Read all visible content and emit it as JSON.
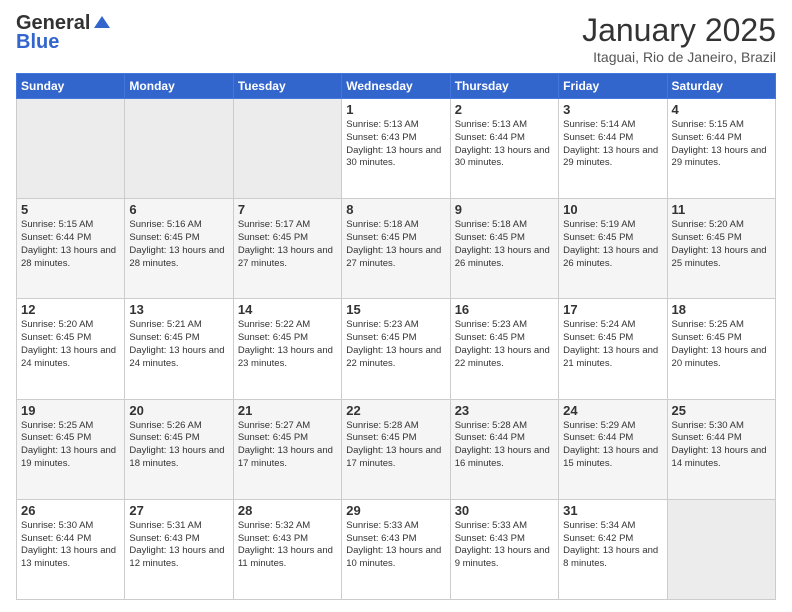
{
  "header": {
    "logo_general": "General",
    "logo_blue": "Blue",
    "month": "January 2025",
    "location": "Itaguai, Rio de Janeiro, Brazil"
  },
  "days_of_week": [
    "Sunday",
    "Monday",
    "Tuesday",
    "Wednesday",
    "Thursday",
    "Friday",
    "Saturday"
  ],
  "weeks": [
    [
      {
        "day": "",
        "info": ""
      },
      {
        "day": "",
        "info": ""
      },
      {
        "day": "",
        "info": ""
      },
      {
        "day": "1",
        "info": "Sunrise: 5:13 AM\nSunset: 6:43 PM\nDaylight: 13 hours and 30 minutes."
      },
      {
        "day": "2",
        "info": "Sunrise: 5:13 AM\nSunset: 6:44 PM\nDaylight: 13 hours and 30 minutes."
      },
      {
        "day": "3",
        "info": "Sunrise: 5:14 AM\nSunset: 6:44 PM\nDaylight: 13 hours and 29 minutes."
      },
      {
        "day": "4",
        "info": "Sunrise: 5:15 AM\nSunset: 6:44 PM\nDaylight: 13 hours and 29 minutes."
      }
    ],
    [
      {
        "day": "5",
        "info": "Sunrise: 5:15 AM\nSunset: 6:44 PM\nDaylight: 13 hours and 28 minutes."
      },
      {
        "day": "6",
        "info": "Sunrise: 5:16 AM\nSunset: 6:45 PM\nDaylight: 13 hours and 28 minutes."
      },
      {
        "day": "7",
        "info": "Sunrise: 5:17 AM\nSunset: 6:45 PM\nDaylight: 13 hours and 27 minutes."
      },
      {
        "day": "8",
        "info": "Sunrise: 5:18 AM\nSunset: 6:45 PM\nDaylight: 13 hours and 27 minutes."
      },
      {
        "day": "9",
        "info": "Sunrise: 5:18 AM\nSunset: 6:45 PM\nDaylight: 13 hours and 26 minutes."
      },
      {
        "day": "10",
        "info": "Sunrise: 5:19 AM\nSunset: 6:45 PM\nDaylight: 13 hours and 26 minutes."
      },
      {
        "day": "11",
        "info": "Sunrise: 5:20 AM\nSunset: 6:45 PM\nDaylight: 13 hours and 25 minutes."
      }
    ],
    [
      {
        "day": "12",
        "info": "Sunrise: 5:20 AM\nSunset: 6:45 PM\nDaylight: 13 hours and 24 minutes."
      },
      {
        "day": "13",
        "info": "Sunrise: 5:21 AM\nSunset: 6:45 PM\nDaylight: 13 hours and 24 minutes."
      },
      {
        "day": "14",
        "info": "Sunrise: 5:22 AM\nSunset: 6:45 PM\nDaylight: 13 hours and 23 minutes."
      },
      {
        "day": "15",
        "info": "Sunrise: 5:23 AM\nSunset: 6:45 PM\nDaylight: 13 hours and 22 minutes."
      },
      {
        "day": "16",
        "info": "Sunrise: 5:23 AM\nSunset: 6:45 PM\nDaylight: 13 hours and 22 minutes."
      },
      {
        "day": "17",
        "info": "Sunrise: 5:24 AM\nSunset: 6:45 PM\nDaylight: 13 hours and 21 minutes."
      },
      {
        "day": "18",
        "info": "Sunrise: 5:25 AM\nSunset: 6:45 PM\nDaylight: 13 hours and 20 minutes."
      }
    ],
    [
      {
        "day": "19",
        "info": "Sunrise: 5:25 AM\nSunset: 6:45 PM\nDaylight: 13 hours and 19 minutes."
      },
      {
        "day": "20",
        "info": "Sunrise: 5:26 AM\nSunset: 6:45 PM\nDaylight: 13 hours and 18 minutes."
      },
      {
        "day": "21",
        "info": "Sunrise: 5:27 AM\nSunset: 6:45 PM\nDaylight: 13 hours and 17 minutes."
      },
      {
        "day": "22",
        "info": "Sunrise: 5:28 AM\nSunset: 6:45 PM\nDaylight: 13 hours and 17 minutes."
      },
      {
        "day": "23",
        "info": "Sunrise: 5:28 AM\nSunset: 6:44 PM\nDaylight: 13 hours and 16 minutes."
      },
      {
        "day": "24",
        "info": "Sunrise: 5:29 AM\nSunset: 6:44 PM\nDaylight: 13 hours and 15 minutes."
      },
      {
        "day": "25",
        "info": "Sunrise: 5:30 AM\nSunset: 6:44 PM\nDaylight: 13 hours and 14 minutes."
      }
    ],
    [
      {
        "day": "26",
        "info": "Sunrise: 5:30 AM\nSunset: 6:44 PM\nDaylight: 13 hours and 13 minutes."
      },
      {
        "day": "27",
        "info": "Sunrise: 5:31 AM\nSunset: 6:43 PM\nDaylight: 13 hours and 12 minutes."
      },
      {
        "day": "28",
        "info": "Sunrise: 5:32 AM\nSunset: 6:43 PM\nDaylight: 13 hours and 11 minutes."
      },
      {
        "day": "29",
        "info": "Sunrise: 5:33 AM\nSunset: 6:43 PM\nDaylight: 13 hours and 10 minutes."
      },
      {
        "day": "30",
        "info": "Sunrise: 5:33 AM\nSunset: 6:43 PM\nDaylight: 13 hours and 9 minutes."
      },
      {
        "day": "31",
        "info": "Sunrise: 5:34 AM\nSunset: 6:42 PM\nDaylight: 13 hours and 8 minutes."
      },
      {
        "day": "",
        "info": ""
      }
    ]
  ]
}
